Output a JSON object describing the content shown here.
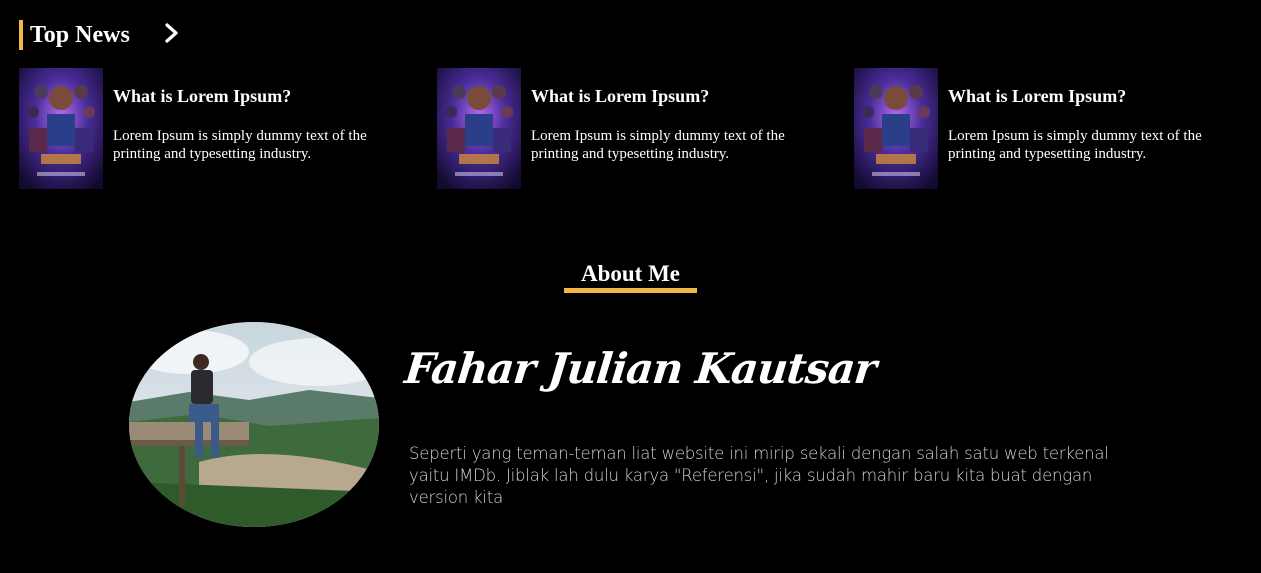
{
  "top_news": {
    "title": "Top News",
    "items": [
      {
        "title": "What is Lorem Ipsum?",
        "body": "Lorem Ipsum is simply dummy text of the printing and typesetting industry."
      },
      {
        "title": "What is Lorem Ipsum?",
        "body": "Lorem Ipsum is simply dummy text of the printing and typesetting industry."
      },
      {
        "title": "What is Lorem Ipsum?",
        "body": "Lorem Ipsum is simply dummy text of the printing and typesetting industry."
      }
    ]
  },
  "about": {
    "title": "About Me",
    "name": "Fahar Julian Kautsar",
    "description": "Seperti yang teman-teman liat website ini mirip sekali dengan salah satu web terkenal yaitu IMDb. Jiblak lah dulu karya \"Referensi\", jika sudah mahir baru kita buat dengan version kita"
  },
  "colors": {
    "background": "#000000",
    "accent": "#f2b744",
    "text": "#ffffff"
  },
  "icons": {
    "next": "chevron-right-icon"
  }
}
